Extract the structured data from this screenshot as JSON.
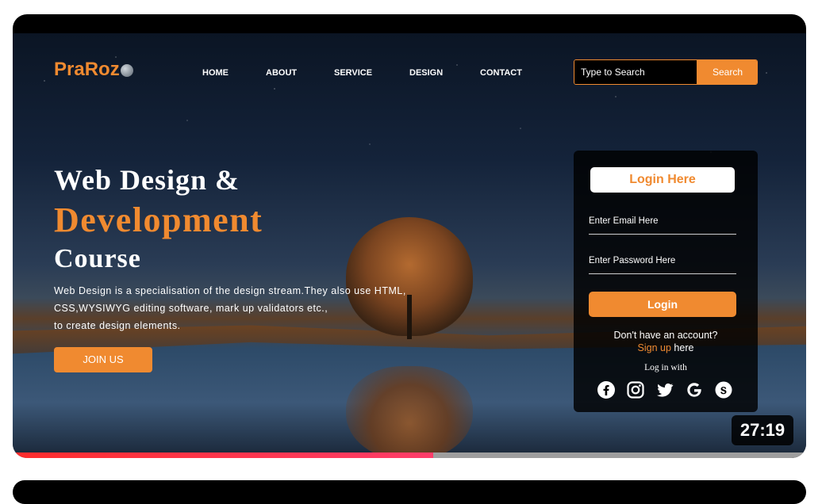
{
  "site": {
    "logo_text": "PraRoz",
    "logo_icon": "globe-icon"
  },
  "nav": {
    "items": [
      {
        "label": "HOME"
      },
      {
        "label": "ABOUT"
      },
      {
        "label": "SERVICE"
      },
      {
        "label": "DESIGN"
      },
      {
        "label": "CONTACT"
      }
    ]
  },
  "search": {
    "placeholder": "Type to Search",
    "button_label": "Search"
  },
  "hero": {
    "line1": "Web Design &",
    "line2": "Development",
    "line3": "Course",
    "description": [
      "Web Design is a specialisation of the design stream.They also use HTML,",
      "CSS,WYSIWYG editing software, mark up validators etc.,",
      "to create design elements."
    ],
    "cta_label": "JOIN US"
  },
  "login": {
    "title": "Login Here",
    "email_placeholder": "Enter Email Here",
    "password_placeholder": "Enter Password Here",
    "button_label": "Login",
    "no_account": "Don't have an account?",
    "signup_link": "Sign up",
    "signup_suffix": " here",
    "login_with": "Log in with",
    "social_icons": [
      "facebook-icon",
      "instagram-icon",
      "twitter-icon",
      "google-icon",
      "skype-icon"
    ]
  },
  "video": {
    "duration": "27:19",
    "progress_fraction": 0.53
  },
  "colors": {
    "accent": "#f08a30",
    "progress": "#ff2d2d",
    "track": "#9e9e9e"
  }
}
